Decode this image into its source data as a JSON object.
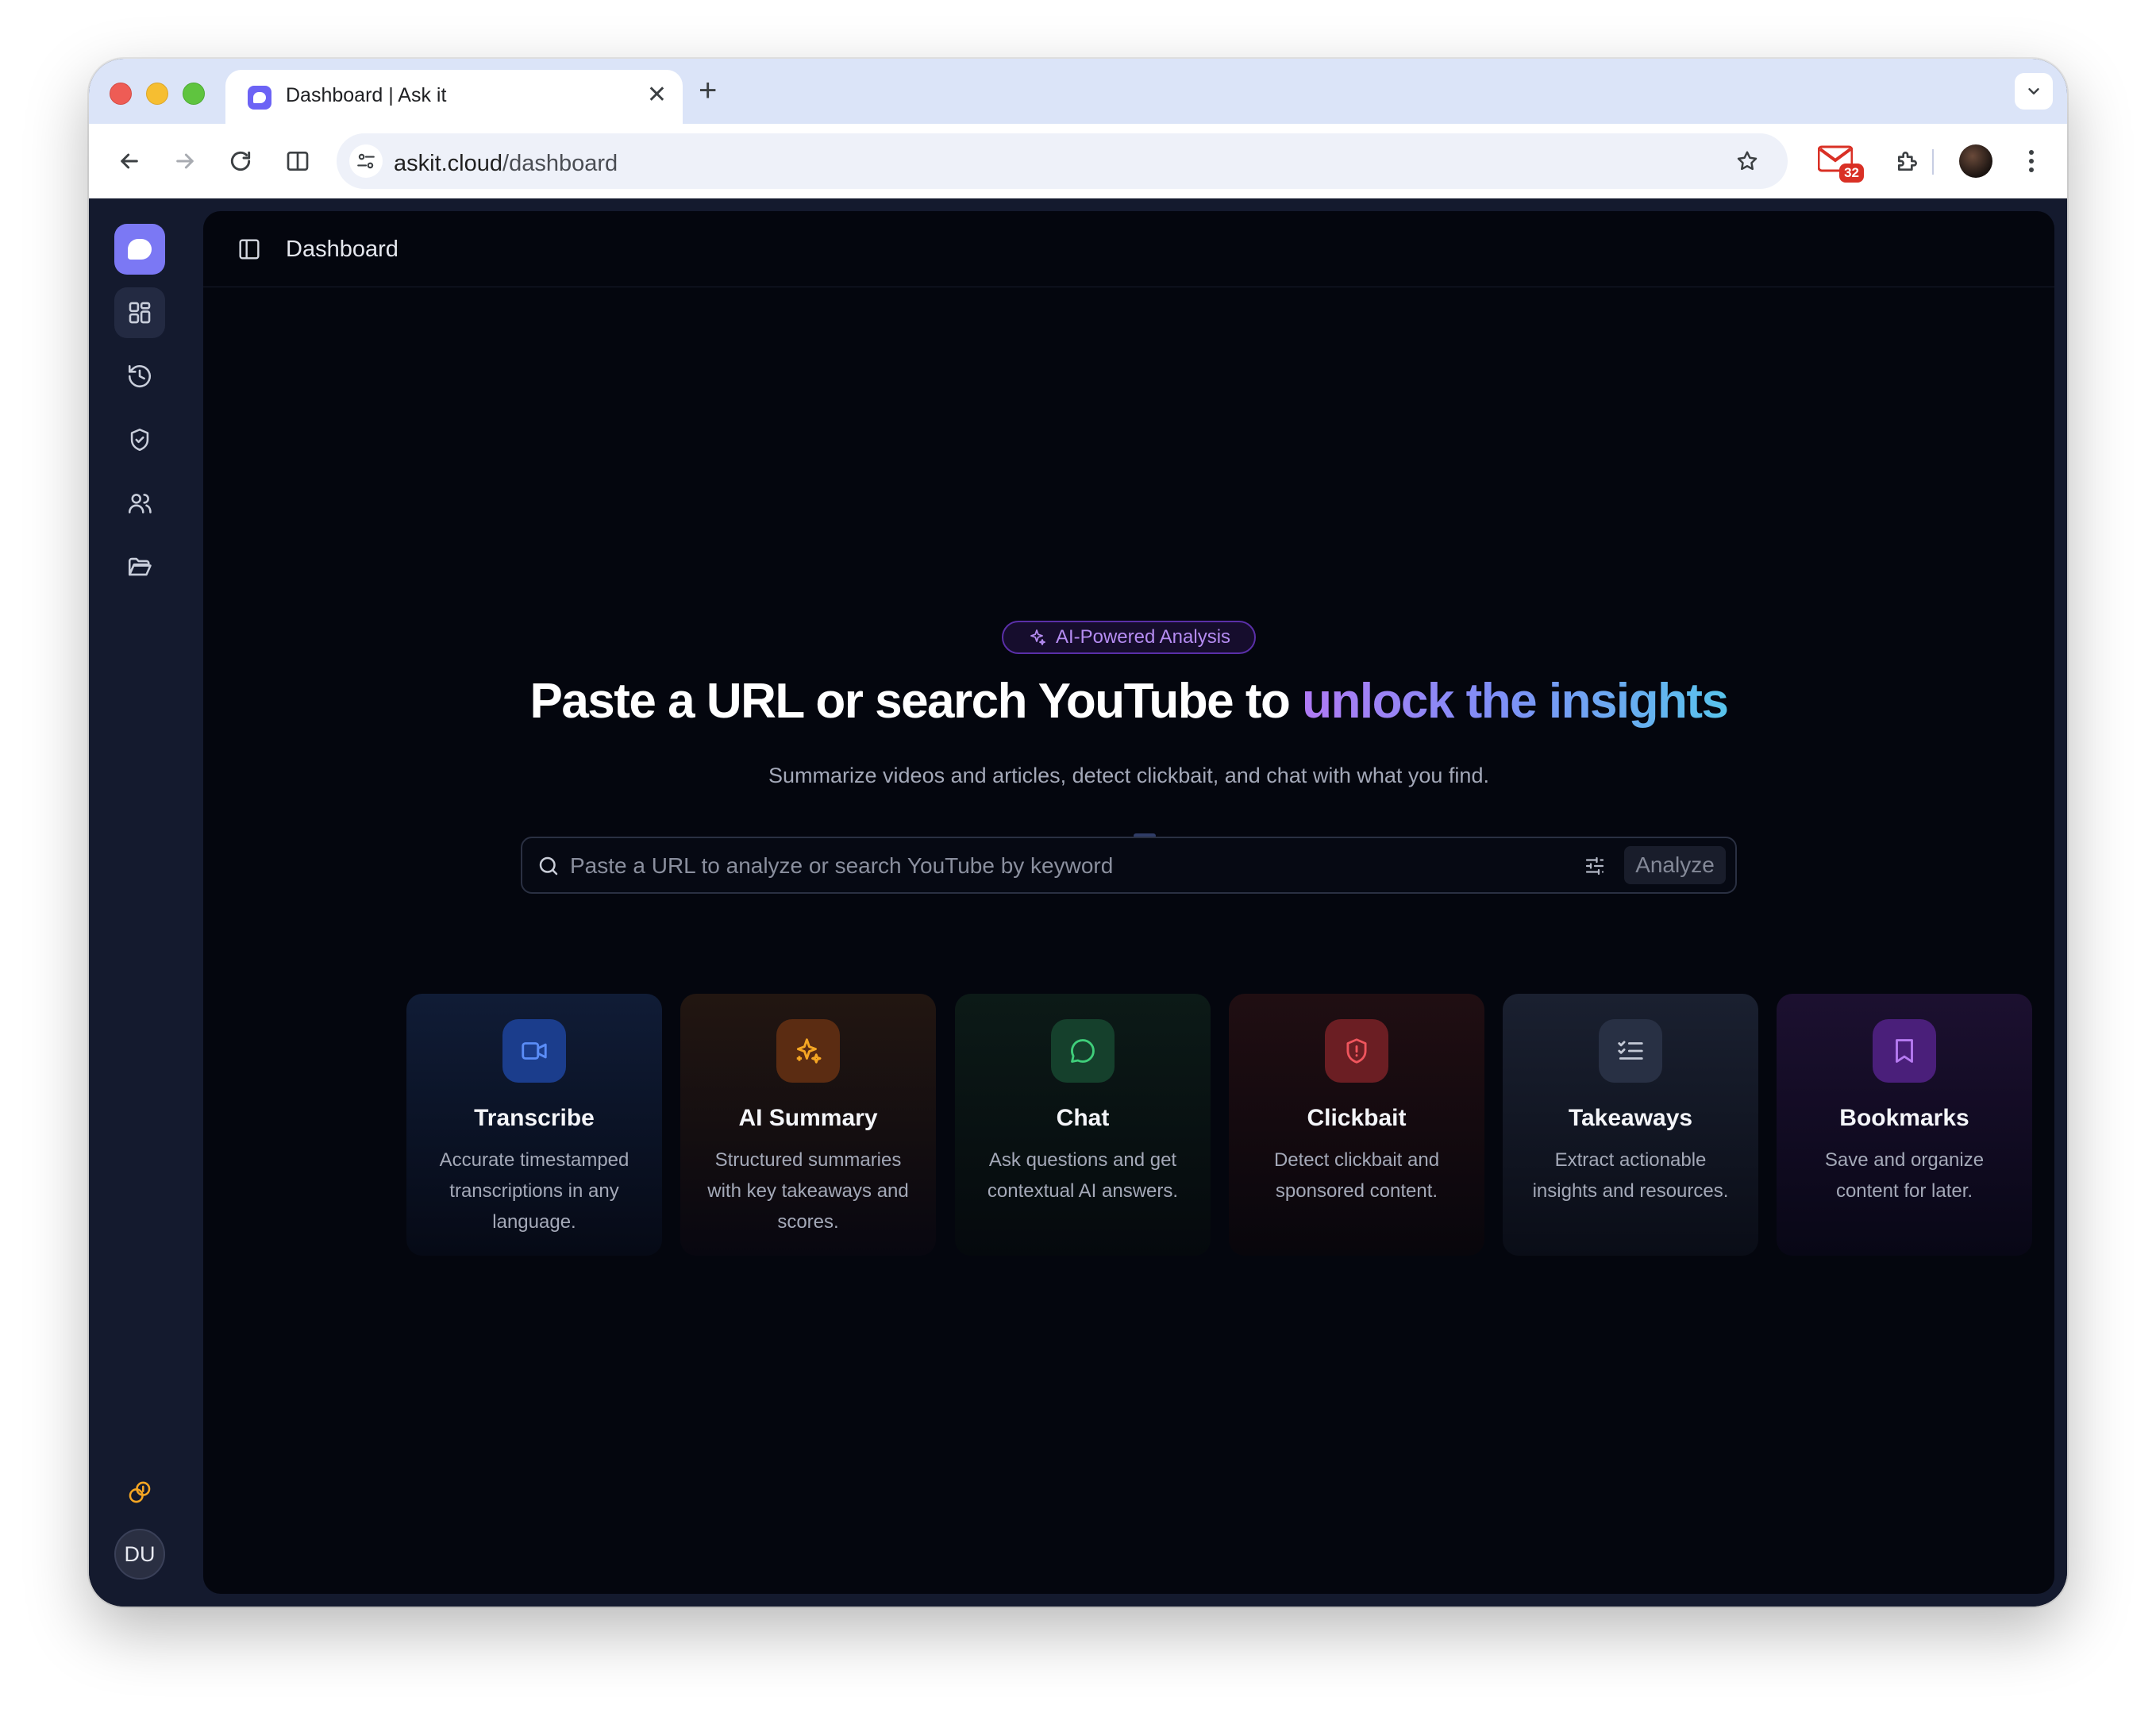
{
  "browser": {
    "tab_title": "Dashboard | Ask it",
    "url_host": "askit.cloud",
    "url_path": "/dashboard",
    "extension_badge": "32"
  },
  "sidebar": {
    "items": [
      {
        "name": "dashboard",
        "icon": "grid-icon",
        "active": true
      },
      {
        "name": "history",
        "icon": "history-icon",
        "active": false
      },
      {
        "name": "clickbait",
        "icon": "shield-icon",
        "active": false
      },
      {
        "name": "people",
        "icon": "users-icon",
        "active": false
      },
      {
        "name": "library",
        "icon": "folder-icon",
        "active": false
      }
    ],
    "bottom_icon": "coins-icon",
    "user_initials": "DU"
  },
  "header": {
    "title": "Dashboard"
  },
  "hero": {
    "badge": "AI-Powered Analysis",
    "headline_plain": "Paste a URL or search YouTube to ",
    "headline_highlight": "unlock the insights",
    "subtitle": "Summarize videos and articles, detect clickbait, and chat with what you find."
  },
  "search": {
    "placeholder": "Paste a URL to analyze or search YouTube by keyword",
    "value": "",
    "button_label": "Analyze"
  },
  "features": [
    {
      "title": "Transcribe",
      "description": "Accurate timestamped transcriptions in any language.",
      "icon": "video-icon",
      "color": "#4f7ff0"
    },
    {
      "title": "AI Summary",
      "description": "Structured summaries with key takeaways and scores.",
      "icon": "sparkles-icon",
      "color": "#f5a623"
    },
    {
      "title": "Chat",
      "description": "Ask questions and get contextual AI answers.",
      "icon": "chat-icon",
      "color": "#3fce7a"
    },
    {
      "title": "Clickbait",
      "description": "Detect clickbait and sponsored content.",
      "icon": "shield-alert-icon",
      "color": "#f0555d"
    },
    {
      "title": "Takeaways",
      "description": "Extract actionable insights and resources.",
      "icon": "list-checks-icon",
      "color": "#c4c9d6"
    },
    {
      "title": "Bookmarks",
      "description": "Save and organize content for later.",
      "icon": "bookmark-icon",
      "color": "#b77bf2"
    }
  ],
  "colors": {
    "accent": "#7b78f4",
    "background": "#04060e",
    "sidebar": "#141a2e"
  }
}
